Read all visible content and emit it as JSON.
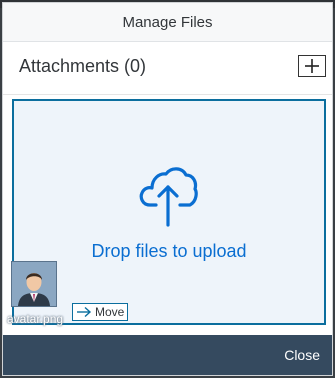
{
  "dialog": {
    "title": "Manage Files",
    "attachments_label": "Attachments (0)",
    "drop_text": "Drop files to upload",
    "file": {
      "name": "avatar.png",
      "move_label": "Move"
    },
    "close_label": "Close"
  },
  "icons": {
    "add": "plus-icon",
    "upload": "cloud-upload-icon",
    "move": "arrow-right-icon",
    "avatar": "person-avatar"
  },
  "colors": {
    "accent": "#0A6ED1",
    "footer": "#354A5F",
    "drop_border": "#0B6E9E",
    "drop_background": "#EEF4FA"
  }
}
